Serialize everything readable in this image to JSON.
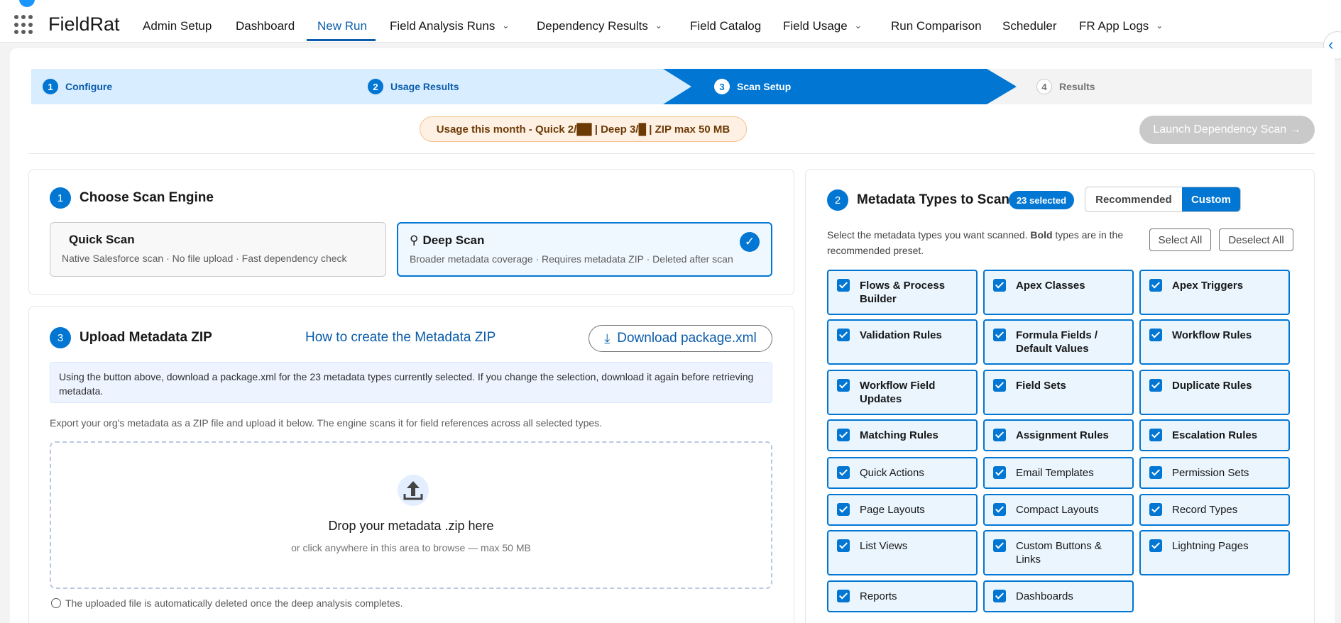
{
  "app": {
    "name": "FieldRat"
  },
  "nav": {
    "items": [
      {
        "label": "Admin Setup"
      },
      {
        "label": "Dashboard"
      },
      {
        "label": "New Run",
        "active": true
      },
      {
        "label": "Field Analysis Runs",
        "has_dropdown": true
      },
      {
        "label": "Dependency Results",
        "has_dropdown": true
      },
      {
        "label": "Field Catalog"
      },
      {
        "label": "Field Usage",
        "has_dropdown": true
      },
      {
        "label": "Run Comparison"
      },
      {
        "label": "Scheduler"
      },
      {
        "label": "FR App Logs",
        "has_dropdown": true
      }
    ]
  },
  "path": {
    "steps": [
      {
        "num": "1",
        "label": "Configure",
        "state": "complete"
      },
      {
        "num": "2",
        "label": "Usage Results",
        "state": "complete"
      },
      {
        "num": "3",
        "label": "Scan Setup",
        "state": "current"
      },
      {
        "num": "4",
        "label": "Results",
        "state": "incomplete"
      }
    ]
  },
  "usage_banner": "Usage this month - Quick 2/██ | Deep 3/█ | ZIP max 50 MB",
  "launch_button": "Launch Dependency Scan →",
  "engine_panel": {
    "num": "1",
    "title": "Choose Scan Engine",
    "quick": {
      "title": "Quick Scan",
      "desc": "Native Salesforce scan · No file upload · Fast dependency check",
      "selected": false
    },
    "deep": {
      "title": "Deep Scan",
      "desc": "Broader metadata coverage · Requires metadata ZIP · Deleted after scan",
      "selected": true
    }
  },
  "upload_panel": {
    "num": "3",
    "title": "Upload Metadata ZIP",
    "howto_link": "How to create the Metadata ZIP",
    "download_button": "Download package.xml",
    "info": "Using the button above, download a package.xml for the 23 metadata types currently selected. If you change the selection, download it again before retrieving metadata.",
    "export_text": "Export your org's metadata as a ZIP file and upload it below. The engine scans it for field references across all selected types.",
    "dropzone_title": "Drop your metadata .zip here",
    "dropzone_sub": "or click anywhere in this area to browse — max 50 MB",
    "footnote": "The uploaded file is automatically deleted once the deep analysis completes."
  },
  "metadata_panel": {
    "num": "2",
    "title": "Metadata Types to Scan",
    "selected_count": "23 selected",
    "segments": {
      "recommended": "Recommended",
      "custom": "Custom",
      "active": "custom"
    },
    "desc_prefix": "Select the metadata types you want scanned. ",
    "desc_bold": "Bold",
    "desc_suffix": " types are in the recommended preset.",
    "select_all": "Select All",
    "deselect_all": "Deselect All",
    "types": [
      {
        "label": "Flows & Process Builder",
        "bold": true,
        "checked": true
      },
      {
        "label": "Apex Classes",
        "bold": true,
        "checked": true
      },
      {
        "label": "Apex Triggers",
        "bold": true,
        "checked": true
      },
      {
        "label": "Validation Rules",
        "bold": true,
        "checked": true
      },
      {
        "label": "Formula Fields / Default Values",
        "bold": true,
        "checked": true
      },
      {
        "label": "Workflow Rules",
        "bold": true,
        "checked": true
      },
      {
        "label": "Workflow Field Updates",
        "bold": true,
        "checked": true
      },
      {
        "label": "Field Sets",
        "bold": true,
        "checked": true
      },
      {
        "label": "Duplicate Rules",
        "bold": true,
        "checked": true
      },
      {
        "label": "Matching Rules",
        "bold": true,
        "checked": true
      },
      {
        "label": "Assignment Rules",
        "bold": true,
        "checked": true
      },
      {
        "label": "Escalation Rules",
        "bold": true,
        "checked": true
      },
      {
        "label": "Quick Actions",
        "bold": false,
        "checked": true
      },
      {
        "label": "Email Templates",
        "bold": false,
        "checked": true
      },
      {
        "label": "Permission Sets",
        "bold": false,
        "checked": true
      },
      {
        "label": "Page Layouts",
        "bold": false,
        "checked": true
      },
      {
        "label": "Compact Layouts",
        "bold": false,
        "checked": true
      },
      {
        "label": "Record Types",
        "bold": false,
        "checked": true
      },
      {
        "label": "List Views",
        "bold": false,
        "checked": true
      },
      {
        "label": "Custom Buttons & Links",
        "bold": false,
        "checked": true
      },
      {
        "label": "Lightning Pages",
        "bold": false,
        "checked": true
      },
      {
        "label": "Reports",
        "bold": false,
        "checked": true
      },
      {
        "label": "Dashboards",
        "bold": false,
        "checked": true
      }
    ]
  }
}
